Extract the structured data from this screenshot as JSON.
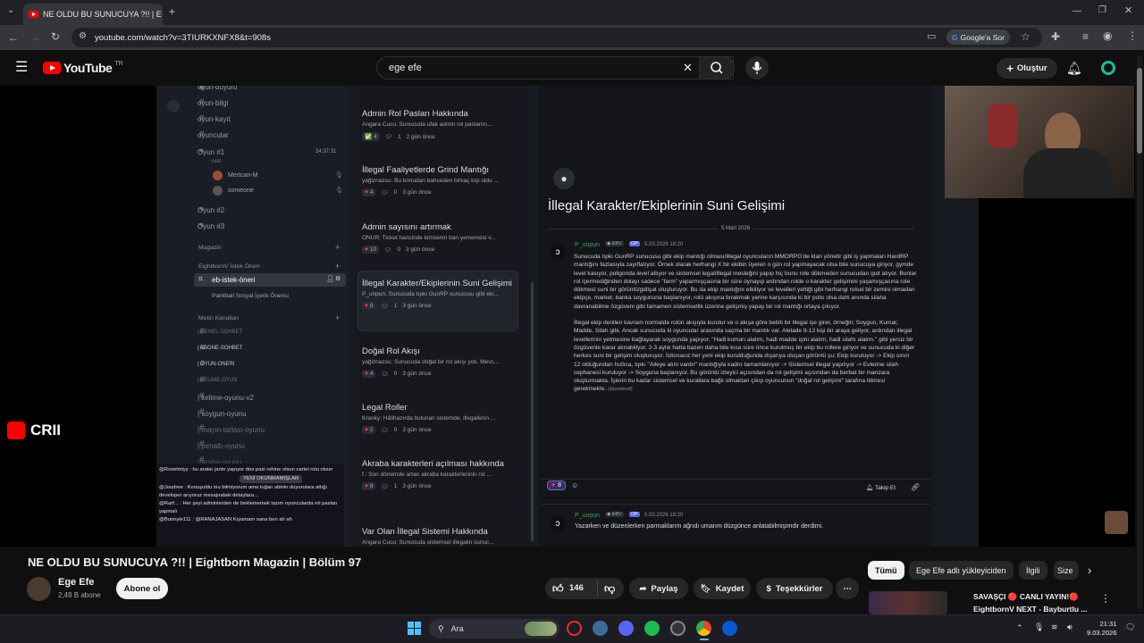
{
  "browser": {
    "tab_title": "NE OLDU BU SUNUCUYA ?!! | E",
    "url": "youtube.com/watch?v=3TIURKXNFX8&t=908s",
    "google_sor": "Google'a Sor"
  },
  "youtube": {
    "logo_text": "YouTube",
    "region": "TR",
    "search_query": "ege efe",
    "create_label": "Oluştur"
  },
  "discord": {
    "channels": [
      {
        "name": "oyun-duyuru",
        "kind": "voice-or-text"
      },
      {
        "name": "oyun-bilgi",
        "kind": "text"
      },
      {
        "name": "oyun-kayıt",
        "kind": "text"
      },
      {
        "name": "oyuncular",
        "kind": "text"
      },
      {
        "name": "Oyun #1",
        "kind": "voice",
        "time": "24:37:31",
        "sub": "rust"
      },
      {
        "name": "Mertcan-M",
        "kind": "user"
      },
      {
        "name": "someone",
        "kind": "user"
      },
      {
        "name": "Oyun #2",
        "kind": "voice"
      },
      {
        "name": "Oyun #3",
        "kind": "voice"
      }
    ],
    "cat_magazin": "Magazin",
    "cat_istek": "EightbornV İstek Önerí",
    "active_channel": "eb-istek-öneri",
    "active_sub": "Paintball Sosyal İçerik Önerisi",
    "cat_metin": "Metin Kanalları",
    "text_channels": [
      "| GENEL-SOHBET",
      "| ABONE-SOHBET",
      "| OYUN-ONERI",
      "| KELIME-OYUN",
      "| kelime-oyunu-v2",
      "| soygun-oyunu",
      "| mayın-tarlası-oyunu",
      "| penaltı-oyunu",
      "| araba-oyunu"
    ],
    "threads": [
      {
        "title": "Admin Rol Pasları Hakkında",
        "preview": "Angara Cucu: Sunucuda ufak admin rol paslarını...",
        "reacts": "4",
        "comments": "1",
        "ago": "2 gün önce"
      },
      {
        "title": "İllegal Faaliyetlerde Grind Mantığı",
        "preview": "yağiznazsu: Bu konudan bahseden birkaç kişi oldu ...",
        "reacts": "4",
        "comments": "0",
        "ago": "3 gün önce"
      },
      {
        "title": "Admin sayısını artırmak",
        "preview": "ONUR: Ticket haricinde kimsenin ban yememesi v...",
        "reacts": "10",
        "comments": "0",
        "ago": "3 gün önce"
      },
      {
        "title": "İllegal Karakter/Ekiplerinin Suni Gelişimi",
        "preview": "P_unpun: Sunucuda tıpkı GunRP sunucusu gibi eki...",
        "reacts": "8",
        "comments": "1",
        "ago": "3 gün önce"
      },
      {
        "title": "Doğal Rol Akışı",
        "preview": "yağiznazsu: Sunucuda doğal bir rol akışı yok. Mevc...",
        "reacts": "4",
        "comments": "0",
        "ago": "3 gün önce"
      },
      {
        "title": "Legal Roller",
        "preview": "Kranky: Hâlihazırda bulunan sistemde, illegallerin ...",
        "reacts": "2",
        "comments": "0",
        "ago": "3 gün önce"
      },
      {
        "title": "Akraba karakterleri açılması hakkında",
        "preview": "f.: Son dönemde artan akraba karakterlerinin rol ...",
        "reacts": "8",
        "comments": "1",
        "ago": "3 gün önce"
      },
      {
        "title": "Var Olan İllegal Sistemi Hakkında",
        "preview": "Angara Cucu: Sunucuda sistemsel illegalin sunuc...",
        "reacts": "",
        "comments": "",
        "ago": ""
      }
    ],
    "post": {
      "title": "İllegal Karakter/Ekiplerinin Suni Gelişimi",
      "date_divider": "5 Mart 2026",
      "author": "P_unpun",
      "timestamp": "5.03.2026 18:20",
      "paragraph1": "Sunucuda tıpkı GunRP sunucusu gibi ekip mantığı olması/illegal oyuncuların MMORPG'de klan yönetir gibi iş yapmaları HardRP mantığını fazlasıyla zayıflatıyor. Örnek olarak herhangi X bir ekibin üyeleri o gün rol yapmayacak olsa bile sunucuya giriyor, gymde level kasıyor, poligonda level atlıyor ve sistemsel legal/illegal mesleğini yapıp hiç bunu role dökmeden sunucudan quit atıyor. Bunlar rol içermediğinden dolayı sadece \"farm\" yaparmışçasına bir süre oynayıp ardından rolde o karakter gelişimini yaşamışçasına role dökmesi suni bir görüntü/gidişat oluşturuyor. Bu da ekip mantığını etkiliyor ve levelleri yettiği gibi herhangi rolsel bir zemini olmadan ekipçe, market, banka soygununa başlanıyor, rolü akışına bırakmak yerine karşısında ki bir polis olsa dahi anında silaha davranabilme özgüveni gibi tamamen sistemsellik üzerine gelişmiş yapay bir rol mantığı ortaya çıkıyor.",
      "paragraph2": "İllegal ekip denilen kavram normalde rolün akışıyla kurulur ve o akışa göre belirli bir illegal işe girer, örneğin; Soygun, Kumar, Madde, Silah gibi. Ancak sunucuda ki oyuncular arasında saçma bir mantık var. Alelade 8-12 kişi bir araya geliyor, ardından illegal levellerinin yetmesine bağlayarak soygunda yapıyor, \"Hadi kumarı alalım, hadi madde işini alalım, hadi silahı alalım.\" gibi yersiz bir özgüvenle karar alınabiliyor. 2-3 aylık hatta bazen daha bile kısa süre önce kurulmuş bir ekip bu rollere giriyor ve sunucuda ki diğer herkes suni bir gelişim oluşturuyor. İstisnasız her yeni ekip kurulduğunda dışarıya oluşan görüntü şu; Ekip kuruluyor -> Ekip sınırı 12 olduğundan hızlıca, tıpkı \"Alleye alım vardır\" mantığıyla kadro tamamlanıyor -> Sistemsel illegal yapılıyor -> Evlerine silah cephanesi kuruluyor -> Soyguna başlanıyor. Bu görüntü izleyici açısından da rol gelişimi açısından da berbat bir manzara oluşturmakta. İşlerin bu kadar sistemsel ve kurallara bağlı olmaktan çıkıp oyuncunun \"doğal rol gelişimi\" tarafına itilmesi gerekmekte.",
      "edited": "(düzenlendi)",
      "reactions": "8",
      "follow_label": "Takip Et",
      "reply_author": "P_unpun",
      "reply_timestamp": "5.03.2026 18:20",
      "reply_text": "Yazarken ve düzenlerken parmaklarım ağrıdı umarım düzgünce anlatabilmişimdir derdimi."
    },
    "chat_overlay": [
      "@Roselmiyy : bu aralar janto yapıyor doe pasi rehine olsun cartel rolu olsun",
      "@Joudree : Konuşuldu mu bilmiyorum ama tuğan abinin duyurulara attığı developer arıyoruz mesajındaki detaylara...",
      "@Rarf... : Her şeyi adminlerden de beklememek lazım oyuncularda rol pasları yapmalı",
      "@Bunnyle111 : @RANAJASAN Kıyamam sana ben ah ah"
    ],
    "chat_badge": "YENİ OKUNMAMIŞLAR"
  },
  "overlay_logo": "CRII",
  "video": {
    "title": "NE OLDU BU SUNUCUYA ?!! | Eightborn Magazin | Bölüm 97",
    "channel_name": "Ege Efe",
    "subscribers": "2,49 B abone",
    "subscribe_label": "Abone ol",
    "likes": "146",
    "share_label": "Paylaş",
    "save_label": "Kaydet",
    "thanks_label": "Teşekkürler"
  },
  "chips": [
    "Tümü",
    "Ege Efe adlı yükleyiciden",
    "İlgili",
    "Size"
  ],
  "recommended": {
    "title": "SAVAŞÇI 🔴 CANLI YAYIN!🔴",
    "subtitle": "EightbornV NEXT - Bayburtlu ..."
  },
  "taskbar": {
    "search_label": "Ara",
    "time": "21:31",
    "date": "9.03.2026"
  },
  "colors": {
    "accent_red": "#ff0000",
    "discord_bg": "#181a21",
    "reaction_heart": "#f23f43",
    "yt_bg": "#0f0f0f"
  }
}
